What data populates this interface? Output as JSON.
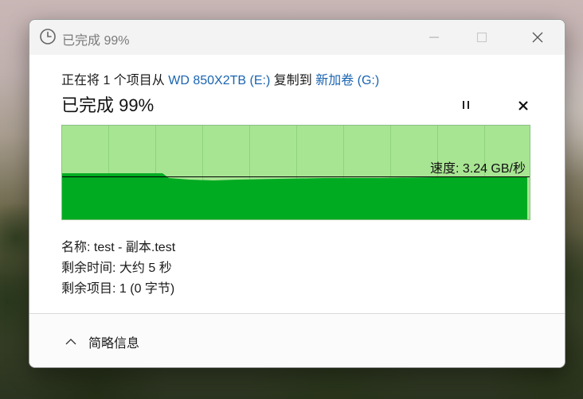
{
  "window": {
    "title": "已完成 99%",
    "icon": "clock-icon",
    "controls": [
      "minimize-icon",
      "maximize-icon",
      "close-icon"
    ]
  },
  "copy": {
    "prefix": "正在将 1 个项目从 ",
    "source": "WD 850X2TB (E:)",
    "middle": " 复制到 ",
    "destination": "新加卷 (G:)",
    "status": "已完成 99%",
    "progress_percent": 99
  },
  "graph": {
    "speed_text": "速度: 3.24 GB/秒",
    "colors": {
      "completed_area": "#00ab22",
      "graph_background": "#a8e593",
      "grid": "#8fd27c",
      "speed_line": "#000000"
    }
  },
  "details": {
    "name_label": "名称: ",
    "name_value": "test - 副本.test",
    "time_label": "剩余时间: ",
    "time_value": "大约 5 秒",
    "items_label": "剩余项目: ",
    "items_value": "1 (0 字节)"
  },
  "footer": {
    "less_info_label": "简略信息",
    "less_info_icon": "chevron-up-icon"
  }
}
